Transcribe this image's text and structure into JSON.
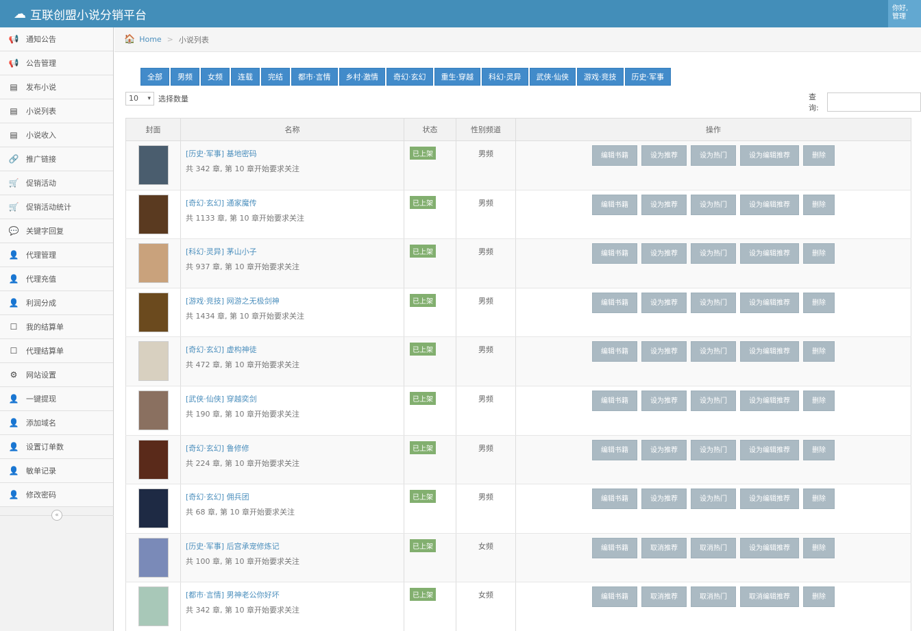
{
  "app": {
    "title": "互联创盟小说分销平台",
    "user": "你好,",
    "user_role": "管理"
  },
  "sidebar": {
    "items": [
      {
        "label": "通知公告",
        "icon": "megaphone-icon",
        "glyph": "📢"
      },
      {
        "label": "公告管理",
        "icon": "megaphone-icon",
        "glyph": "📢"
      },
      {
        "label": "发布小说",
        "icon": "list-icon",
        "glyph": "▤"
      },
      {
        "label": "小说列表",
        "icon": "list-icon",
        "glyph": "▤"
      },
      {
        "label": "小说收入",
        "icon": "list-icon",
        "glyph": "▤"
      },
      {
        "label": "推广链接",
        "icon": "link-icon",
        "glyph": "🔗"
      },
      {
        "label": "促销活动",
        "icon": "cart-icon",
        "glyph": "🛒"
      },
      {
        "label": "促销活动统计",
        "icon": "cart-icon",
        "glyph": "🛒"
      },
      {
        "label": "关键字回复",
        "icon": "comment-icon",
        "glyph": "💬"
      },
      {
        "label": "代理管理",
        "icon": "user-add-icon",
        "glyph": "👤"
      },
      {
        "label": "代理充值",
        "icon": "user-add-icon",
        "glyph": "👤"
      },
      {
        "label": "利润分成",
        "icon": "user-add-icon",
        "glyph": "👤"
      },
      {
        "label": "我的结算单",
        "icon": "checkbox-icon",
        "glyph": "☐"
      },
      {
        "label": "代理结算单",
        "icon": "checkbox-icon",
        "glyph": "☐"
      },
      {
        "label": "网站设置",
        "icon": "gears-icon",
        "glyph": "⚙"
      },
      {
        "label": "一键提现",
        "icon": "user-add-icon",
        "glyph": "👤"
      },
      {
        "label": "添加域名",
        "icon": "user-add-icon",
        "glyph": "👤"
      },
      {
        "label": "设置订单数",
        "icon": "user-add-icon",
        "glyph": "👤"
      },
      {
        "label": "敏单记录",
        "icon": "user-add-icon",
        "glyph": "👤"
      },
      {
        "label": "修改密码",
        "icon": "user-add-icon",
        "glyph": "👤"
      }
    ],
    "collapse_glyph": "«"
  },
  "breadcrumb": {
    "home": "Home",
    "current": "小说列表"
  },
  "filters": [
    "全部",
    "男频",
    "女频",
    "连载",
    "完结",
    "都市·言情",
    "乡村·激情",
    "奇幻·玄幻",
    "重生·穿越",
    "科幻·灵异",
    "武侠·仙侠",
    "游戏·竞技",
    "历史·军事"
  ],
  "controls": {
    "page_size": "10",
    "page_size_label": "选择数量",
    "search_label": "查询:"
  },
  "table": {
    "headers": [
      "封面",
      "名称",
      "状态",
      "性别频道",
      "操作"
    ],
    "rows": [
      {
        "title": "[历史·军事] 基地密码",
        "desc": "共 342 章, 第 10 章开始要求关注",
        "status": "已上架",
        "gender": "男频",
        "ops": [
          "编辑书籍",
          "设为推荐",
          "设为热门",
          "设为编辑推荐",
          "删除"
        ],
        "cover_color": "#4a5d6e"
      },
      {
        "title": "[奇幻·玄幻] 通家魔传",
        "desc": "共 1133 章, 第 10 章开始要求关注",
        "status": "已上架",
        "gender": "男频",
        "ops": [
          "编辑书籍",
          "设为推荐",
          "设为热门",
          "设为编辑推荐",
          "删除"
        ],
        "cover_color": "#5a3a20"
      },
      {
        "title": "[科幻·灵异] 茅山小子",
        "desc": "共 937 章, 第 10 章开始要求关注",
        "status": "已上架",
        "gender": "男频",
        "ops": [
          "编辑书籍",
          "设为推荐",
          "设为热门",
          "设为编辑推荐",
          "删除"
        ],
        "cover_color": "#c9a27c"
      },
      {
        "title": "[游戏·竞技] 网游之无极剑神",
        "desc": "共 1434 章, 第 10 章开始要求关注",
        "status": "已上架",
        "gender": "男频",
        "ops": [
          "编辑书籍",
          "设为推荐",
          "设为热门",
          "设为编辑推荐",
          "删除"
        ],
        "cover_color": "#6b4a1e"
      },
      {
        "title": "[奇幻·玄幻] 虚构神徒",
        "desc": "共 472 章, 第 10 章开始要求关注",
        "status": "已上架",
        "gender": "男频",
        "ops": [
          "编辑书籍",
          "设为推荐",
          "设为热门",
          "设为编辑推荐",
          "删除"
        ],
        "cover_color": "#d8d0c0"
      },
      {
        "title": "[武侠·仙侠] 穿越奕剑",
        "desc": "共 190 章, 第 10 章开始要求关注",
        "status": "已上架",
        "gender": "男频",
        "ops": [
          "编辑书籍",
          "设为推荐",
          "设为热门",
          "设为编辑推荐",
          "删除"
        ],
        "cover_color": "#8a7060"
      },
      {
        "title": "[奇幻·玄幻] 鲁修修",
        "desc": "共 224 章, 第 10 章开始要求关注",
        "status": "已上架",
        "gender": "男频",
        "ops": [
          "编辑书籍",
          "设为推荐",
          "设为热门",
          "设为编辑推荐",
          "删除"
        ],
        "cover_color": "#5a2a1a"
      },
      {
        "title": "[奇幻·玄幻] 佣兵团",
        "desc": "共 68 章, 第 10 章开始要求关注",
        "status": "已上架",
        "gender": "男频",
        "ops": [
          "编辑书籍",
          "设为推荐",
          "设为热门",
          "设为编辑推荐",
          "删除"
        ],
        "cover_color": "#1e2a44"
      },
      {
        "title": "[历史·军事] 后宫承宠修炼记",
        "desc": "共 100 章, 第 10 章开始要求关注",
        "status": "已上架",
        "gender": "女频",
        "ops": [
          "编辑书籍",
          "取消推荐",
          "取消热门",
          "设为编辑推荐",
          "删除"
        ],
        "cover_color": "#7a8ab8"
      },
      {
        "title": "[都市·言情] 男神老公你好坏",
        "desc": "共 342 章, 第 10 章开始要求关注",
        "status": "已上架",
        "gender": "女频",
        "ops": [
          "编辑书籍",
          "取消推荐",
          "取消热门",
          "取消编辑推荐",
          "删除"
        ],
        "cover_color": "#a8c8b8"
      }
    ]
  }
}
